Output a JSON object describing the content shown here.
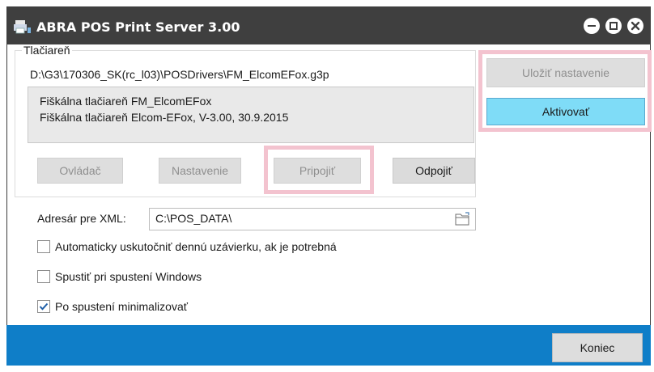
{
  "window": {
    "title": "ABRA POS Print Server 3.00"
  },
  "printer": {
    "group_label": "Tlačiareň",
    "path": "D:\\G3\\170306_SK(rc_l03)\\POSDrivers\\FM_ElcomEFox.g3p",
    "info_line1": "Fiškálna tlačiareň FM_ElcomEFox",
    "info_line2": "Fiškálna tlačiareň Elcom-EFox, V-3.00, 30.9.2015",
    "buttons": {
      "ovladac": "Ovládač",
      "nastavenie": "Nastavenie",
      "pripojit": "Pripojiť",
      "odpojit": "Odpojiť"
    }
  },
  "side_buttons": {
    "ulozit": "Uložiť nastavenie",
    "aktivovat": "Aktivovať"
  },
  "xml": {
    "label": "Adresár pre XML:",
    "value": "C:\\POS_DATA\\"
  },
  "options": [
    {
      "label": "Automaticky uskutočniť dennú uzávierku, ak je potrebná",
      "checked": false
    },
    {
      "label": "Spustiť pri spustení Windows",
      "checked": false
    },
    {
      "label": "Po spustení minimalizovať",
      "checked": true
    }
  ],
  "footer": {
    "koniec": "Koniec"
  },
  "colors": {
    "titlebar": "#3f3f3f",
    "footer": "#0f7ec8",
    "accent_button": "#7fdcf7",
    "highlight": "#f3c3cf",
    "checkmark": "#1f5fa8"
  },
  "icons": {
    "app": "printer-icon",
    "minimize": "minimize-icon",
    "maximize": "maximize-icon",
    "close": "close-icon",
    "folder": "folder-icon",
    "check": "checkmark-icon"
  }
}
